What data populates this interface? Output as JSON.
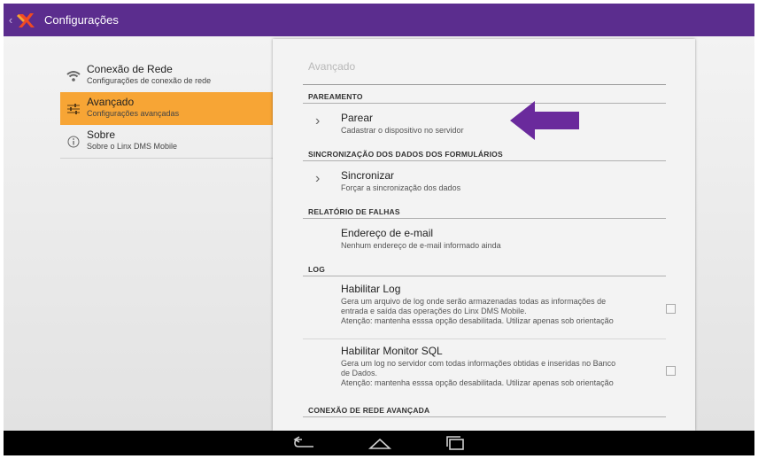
{
  "actionbar": {
    "title": "Configurações",
    "color": "#5b2d8e",
    "back_icon": "chevron-left-icon",
    "logo_icon": "linx-logo-icon"
  },
  "nav": {
    "items": [
      {
        "title": "Conexão de Rede",
        "subtitle": "Configurações de conexão de rede",
        "icon": "wifi-icon",
        "active": false
      },
      {
        "title": "Avançado",
        "subtitle": "Configurações avançadas",
        "icon": "sliders-icon",
        "active": true
      },
      {
        "title": "Sobre",
        "subtitle": "Sobre o Linx DMS Mobile",
        "icon": "info-icon",
        "active": false
      }
    ],
    "active_color": "#f7a535"
  },
  "panel": {
    "title": "Avançado",
    "categories": {
      "pareamento": "PAREAMENTO",
      "sincronizacao": "SINCRONIZAÇÃO DOS DADOS DOS FORMULÁRIOS",
      "relatorio": "RELATÓRIO DE FALHAS",
      "log": "LOG",
      "conexao": "CONEXÃO DE REDE AVANÇADA"
    },
    "prefs": {
      "parear": {
        "title": "Parear",
        "summary": "Cadastrar o dispositivo no servidor"
      },
      "sincronizar": {
        "title": "Sincronizar",
        "summary": "Forçar a sincronização dos dados"
      },
      "email": {
        "title": "Endereço de e-mail",
        "summary": "Nenhum endereço de e-mail informado ainda"
      },
      "habilitar_log": {
        "title": "Habilitar Log",
        "summary": "Gera um arquivo de log onde serão armazenadas todas as informações de entrada e saída das operações do Linx DMS Mobile.\nAtenção: mantenha esssa opção desabilitada. Utilizar apenas sob orientação",
        "checked": false
      },
      "monitor_sql": {
        "title": "Habilitar Monitor SQL",
        "summary": "Gera um log no servidor com todas informações obtidas e inseridas no Banco de Dados.\nAtenção: mantenha esssa opção desabilitada. Utilizar apenas sob orientação",
        "checked": false
      }
    },
    "annotation_arrow_color": "#6a2a9c"
  },
  "navbar": {
    "buttons": [
      "back-icon",
      "home-icon",
      "recents-icon"
    ]
  }
}
